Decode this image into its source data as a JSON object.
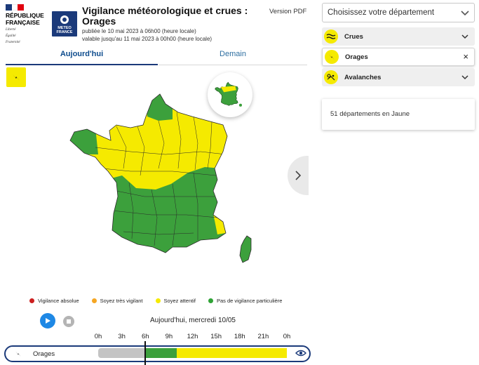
{
  "header": {
    "republic_line1": "RÉPUBLIQUE",
    "republic_line2": "FRANÇAISE",
    "motto_1": "Liberté",
    "motto_2": "Égalité",
    "motto_3": "Fraternité",
    "meteo_logo_text_1": "METEO",
    "meteo_logo_text_2": "FRANCE",
    "title": "Vigilance météorologique et crues : Orages",
    "published": "publiée le 10 mai 2023 à 06h00 (heure locale)",
    "valid_until": "valable jusqu'au 11 mai 2023 à 00h00 (heure locale)",
    "pdf_link": "Version PDF"
  },
  "tabs": [
    {
      "label": "Aujourd'hui",
      "active": true
    },
    {
      "label": "Demain",
      "active": false
    }
  ],
  "map": {
    "current_phenomenon_icon": "lightning-icon",
    "green_color": "#3ca03c",
    "yellow_color": "#f5ea00"
  },
  "legend": [
    {
      "label": "Vigilance absolue",
      "color": "#cc1f1f"
    },
    {
      "label": "Soyez très vigilant",
      "color": "#f5a623"
    },
    {
      "label": "Soyez attentif",
      "color": "#f5ea00"
    },
    {
      "label": "Pas de vigilance particulière",
      "color": "#2fa336"
    }
  ],
  "timeline": {
    "title": "Aujourd'hui, mercredi 10/05",
    "hours": [
      "0h",
      "3h",
      "6h",
      "9h",
      "12h",
      "15h",
      "18h",
      "21h",
      "0h"
    ],
    "row_label": "Orages",
    "segments": [
      {
        "from_hour": 0,
        "to_hour": 6,
        "state": "past",
        "color": "#c4c4c4"
      },
      {
        "from_hour": 6,
        "to_hour": 10,
        "state": "green",
        "color": "#3ca03c"
      },
      {
        "from_hour": 10,
        "to_hour": 24,
        "state": "yellow",
        "color": "#f5ea00"
      }
    ],
    "current_hour": 6
  },
  "sidebar": {
    "select_placeholder": "Choisissez votre département",
    "phenomena": [
      {
        "label": "Crues",
        "icon": "waves-icon",
        "expanded": false
      },
      {
        "label": "Orages",
        "icon": "lightning-icon",
        "selected": true
      },
      {
        "label": "Avalanches",
        "icon": "avalanche-icon",
        "expanded": false
      }
    ],
    "close_glyph": "×",
    "count_text": "51 départements en Jaune"
  }
}
